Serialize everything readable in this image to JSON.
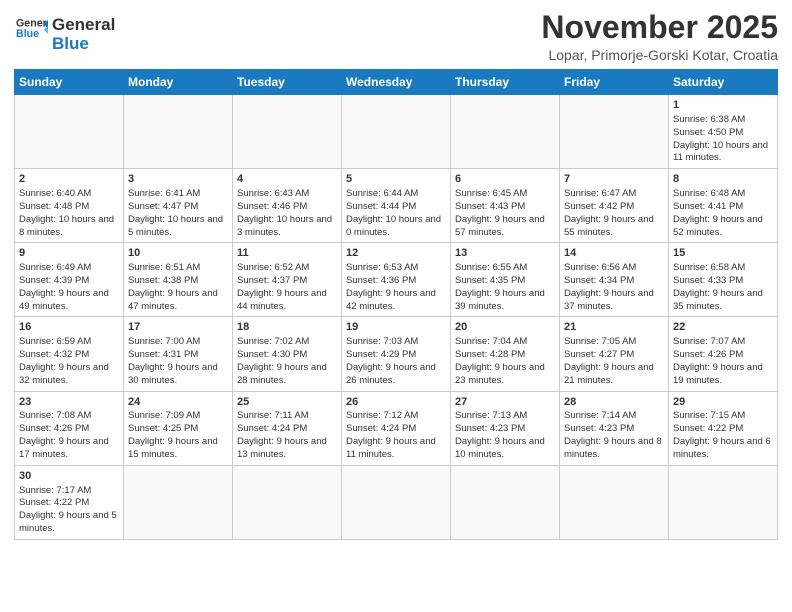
{
  "logo": {
    "line1": "General",
    "line2": "Blue"
  },
  "title": "November 2025",
  "location": "Lopar, Primorje-Gorski Kotar, Croatia",
  "weekdays": [
    "Sunday",
    "Monday",
    "Tuesday",
    "Wednesday",
    "Thursday",
    "Friday",
    "Saturday"
  ],
  "weeks": [
    [
      null,
      null,
      null,
      null,
      null,
      null,
      {
        "day": "1",
        "sunrise": "6:38 AM",
        "sunset": "4:50 PM",
        "daylight": "10 hours and 11 minutes."
      }
    ],
    [
      {
        "day": "2",
        "sunrise": "6:40 AM",
        "sunset": "4:48 PM",
        "daylight": "10 hours and 8 minutes."
      },
      {
        "day": "3",
        "sunrise": "6:41 AM",
        "sunset": "4:47 PM",
        "daylight": "10 hours and 5 minutes."
      },
      {
        "day": "4",
        "sunrise": "6:43 AM",
        "sunset": "4:46 PM",
        "daylight": "10 hours and 3 minutes."
      },
      {
        "day": "5",
        "sunrise": "6:44 AM",
        "sunset": "4:44 PM",
        "daylight": "10 hours and 0 minutes."
      },
      {
        "day": "6",
        "sunrise": "6:45 AM",
        "sunset": "4:43 PM",
        "daylight": "9 hours and 57 minutes."
      },
      {
        "day": "7",
        "sunrise": "6:47 AM",
        "sunset": "4:42 PM",
        "daylight": "9 hours and 55 minutes."
      },
      {
        "day": "8",
        "sunrise": "6:48 AM",
        "sunset": "4:41 PM",
        "daylight": "9 hours and 52 minutes."
      }
    ],
    [
      {
        "day": "9",
        "sunrise": "6:49 AM",
        "sunset": "4:39 PM",
        "daylight": "9 hours and 49 minutes."
      },
      {
        "day": "10",
        "sunrise": "6:51 AM",
        "sunset": "4:38 PM",
        "daylight": "9 hours and 47 minutes."
      },
      {
        "day": "11",
        "sunrise": "6:52 AM",
        "sunset": "4:37 PM",
        "daylight": "9 hours and 44 minutes."
      },
      {
        "day": "12",
        "sunrise": "6:53 AM",
        "sunset": "4:36 PM",
        "daylight": "9 hours and 42 minutes."
      },
      {
        "day": "13",
        "sunrise": "6:55 AM",
        "sunset": "4:35 PM",
        "daylight": "9 hours and 39 minutes."
      },
      {
        "day": "14",
        "sunrise": "6:56 AM",
        "sunset": "4:34 PM",
        "daylight": "9 hours and 37 minutes."
      },
      {
        "day": "15",
        "sunrise": "6:58 AM",
        "sunset": "4:33 PM",
        "daylight": "9 hours and 35 minutes."
      }
    ],
    [
      {
        "day": "16",
        "sunrise": "6:59 AM",
        "sunset": "4:32 PM",
        "daylight": "9 hours and 32 minutes."
      },
      {
        "day": "17",
        "sunrise": "7:00 AM",
        "sunset": "4:31 PM",
        "daylight": "9 hours and 30 minutes."
      },
      {
        "day": "18",
        "sunrise": "7:02 AM",
        "sunset": "4:30 PM",
        "daylight": "9 hours and 28 minutes."
      },
      {
        "day": "19",
        "sunrise": "7:03 AM",
        "sunset": "4:29 PM",
        "daylight": "9 hours and 26 minutes."
      },
      {
        "day": "20",
        "sunrise": "7:04 AM",
        "sunset": "4:28 PM",
        "daylight": "9 hours and 23 minutes."
      },
      {
        "day": "21",
        "sunrise": "7:05 AM",
        "sunset": "4:27 PM",
        "daylight": "9 hours and 21 minutes."
      },
      {
        "day": "22",
        "sunrise": "7:07 AM",
        "sunset": "4:26 PM",
        "daylight": "9 hours and 19 minutes."
      }
    ],
    [
      {
        "day": "23",
        "sunrise": "7:08 AM",
        "sunset": "4:26 PM",
        "daylight": "9 hours and 17 minutes."
      },
      {
        "day": "24",
        "sunrise": "7:09 AM",
        "sunset": "4:25 PM",
        "daylight": "9 hours and 15 minutes."
      },
      {
        "day": "25",
        "sunrise": "7:11 AM",
        "sunset": "4:24 PM",
        "daylight": "9 hours and 13 minutes."
      },
      {
        "day": "26",
        "sunrise": "7:12 AM",
        "sunset": "4:24 PM",
        "daylight": "9 hours and 11 minutes."
      },
      {
        "day": "27",
        "sunrise": "7:13 AM",
        "sunset": "4:23 PM",
        "daylight": "9 hours and 10 minutes."
      },
      {
        "day": "28",
        "sunrise": "7:14 AM",
        "sunset": "4:23 PM",
        "daylight": "9 hours and 8 minutes."
      },
      {
        "day": "29",
        "sunrise": "7:15 AM",
        "sunset": "4:22 PM",
        "daylight": "9 hours and 6 minutes."
      }
    ],
    [
      {
        "day": "30",
        "sunrise": "7:17 AM",
        "sunset": "4:22 PM",
        "daylight": "9 hours and 5 minutes."
      },
      null,
      null,
      null,
      null,
      null,
      null
    ]
  ]
}
